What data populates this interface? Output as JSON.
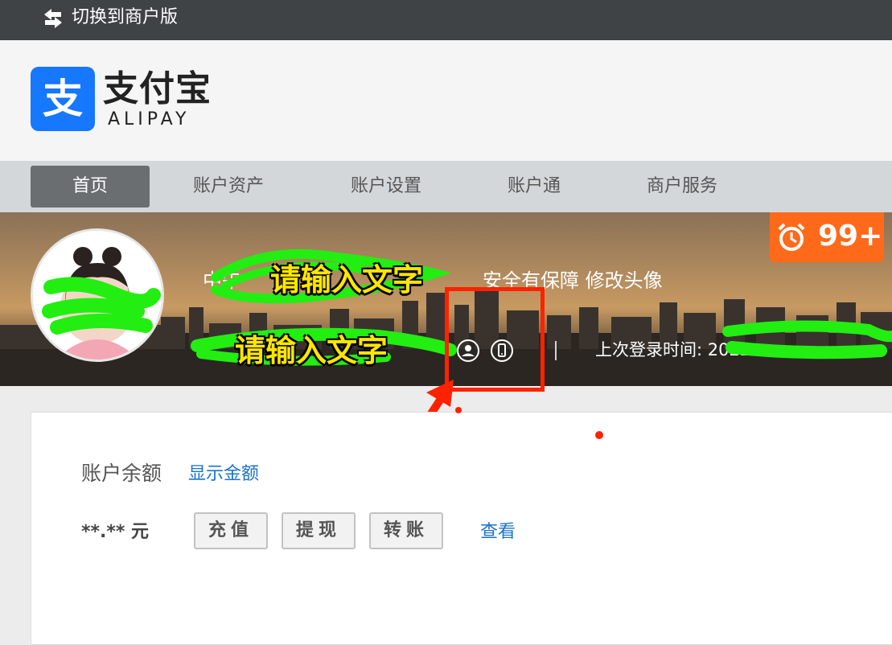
{
  "topbar": {
    "switch_label": "切换到商户版"
  },
  "logo": {
    "glyph": "支",
    "cn": "支付宝",
    "en": "ALIPAY"
  },
  "nav": {
    "items": [
      "首页",
      "账户资产",
      "账户设置",
      "账户通",
      "商户服务"
    ],
    "active": "首页"
  },
  "banner": {
    "name_prefix": "中午",
    "security_text": "安全有保障",
    "edit_avatar": "修改头像",
    "last_login_label": "上次登录时间:",
    "last_login_value": "2022",
    "notification_count": "99+"
  },
  "annotations": {
    "overlay_text_1": "请输入文字",
    "overlay_text_2": "请输入文字"
  },
  "account": {
    "balance_label": "账户余额",
    "show_amount": "显示金额",
    "amount": "**.** 元",
    "buttons": [
      "充值",
      "提现",
      "转账"
    ],
    "view_link": "查看"
  },
  "colors": {
    "brand_blue": "#1677ff",
    "badge_orange": "#ff6a1a",
    "link_blue": "#1a73c8",
    "annotation_red": "#ff2200",
    "annotation_yellow": "#ffe600",
    "scribble_green": "#22ee11"
  }
}
